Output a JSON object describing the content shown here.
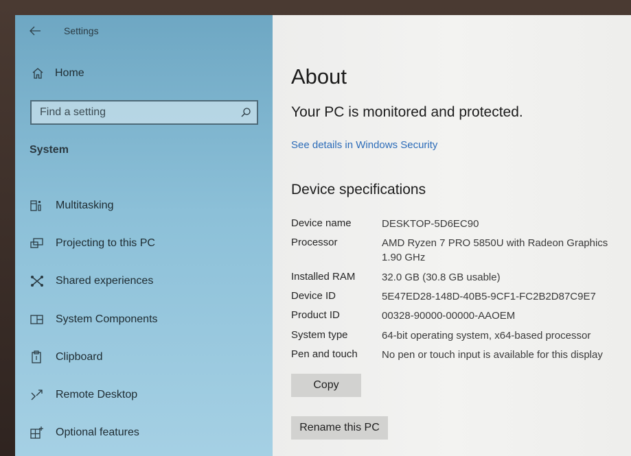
{
  "window": {
    "title": "Settings"
  },
  "sidebar": {
    "home_label": "Home",
    "search": {
      "placeholder": "Find a setting",
      "value": ""
    },
    "section_label": "System",
    "items": [
      {
        "label": "Multitasking",
        "icon": "multitasking-icon"
      },
      {
        "label": "Projecting to this PC",
        "icon": "projecting-icon"
      },
      {
        "label": "Shared experiences",
        "icon": "shared-experiences-icon"
      },
      {
        "label": "System Components",
        "icon": "system-components-icon"
      },
      {
        "label": "Clipboard",
        "icon": "clipboard-icon"
      },
      {
        "label": "Remote Desktop",
        "icon": "remote-desktop-icon"
      },
      {
        "label": "Optional features",
        "icon": "optional-features-icon"
      }
    ]
  },
  "main": {
    "title": "About",
    "status": "Your PC is monitored and protected.",
    "security_link": "See details in Windows Security",
    "specs_heading": "Device specifications",
    "specs": [
      {
        "label": "Device name",
        "value": "DESKTOP-5D6EC90"
      },
      {
        "label": "Processor",
        "value": "AMD Ryzen 7 PRO 5850U with Radeon Graphics 1.90 GHz"
      },
      {
        "label": "Installed RAM",
        "value": "32.0 GB (30.8 GB usable)"
      },
      {
        "label": "Device ID",
        "value": "5E47ED28-148D-40B5-9CF1-FC2B2D87C9E7"
      },
      {
        "label": "Product ID",
        "value": "00328-90000-00000-AAOEM"
      },
      {
        "label": "System type",
        "value": "64-bit operating system, x64-based processor"
      },
      {
        "label": "Pen and touch",
        "value": "No pen or touch input is available for this display"
      }
    ],
    "copy_button": "Copy",
    "rename_button": "Rename this PC"
  },
  "colors": {
    "sidebar_accent": "#8cc0d8",
    "link": "#2b6bb8",
    "button_bg": "#d2d2d0"
  }
}
